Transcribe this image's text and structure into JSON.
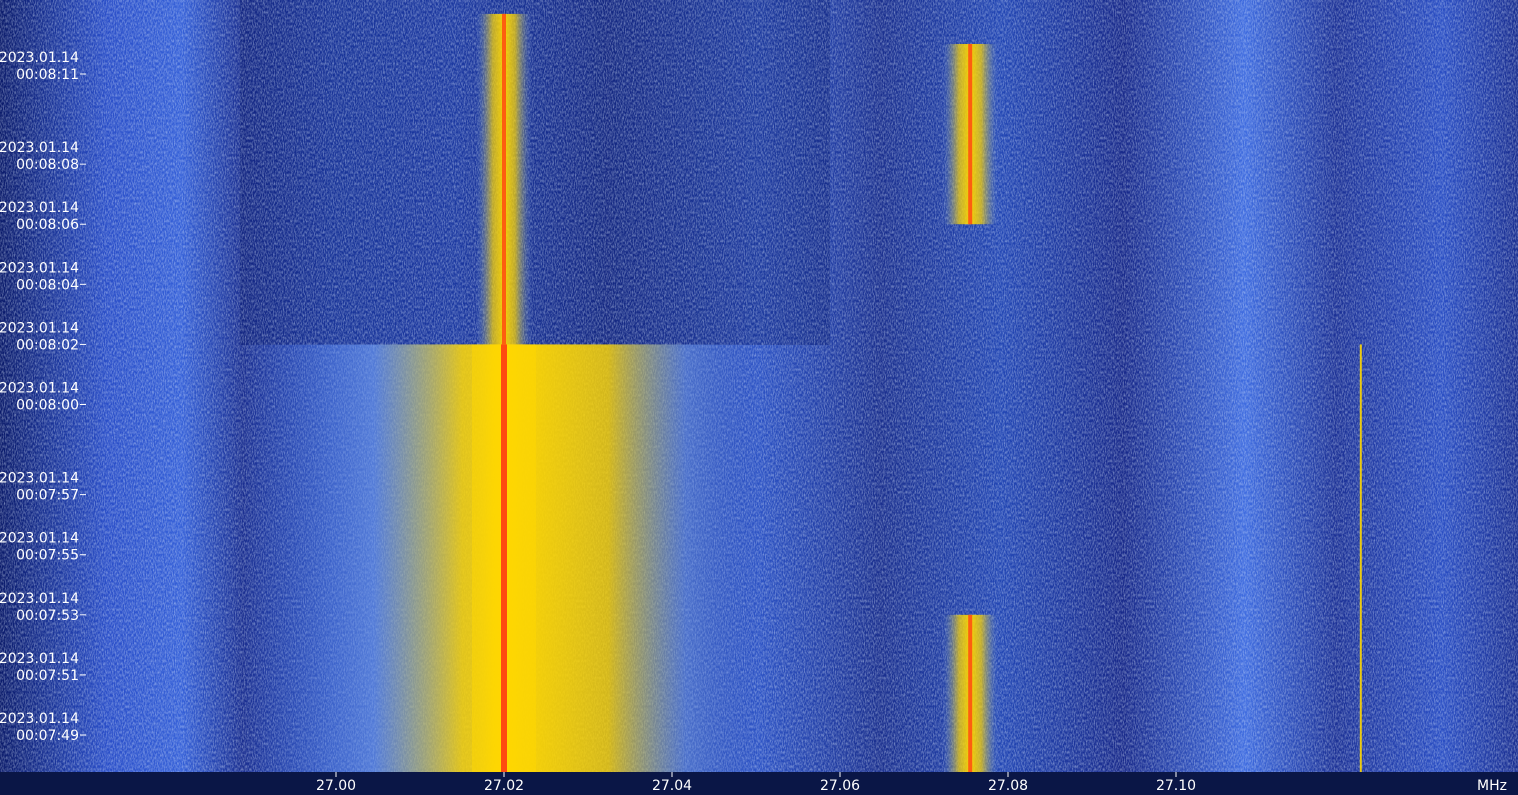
{
  "chart_data": {
    "type": "heatmap",
    "subtype": "waterfall-spectrogram",
    "x_unit_label": "MHz",
    "x_ticks": [
      "27.00",
      "27.02",
      "27.04",
      "27.06",
      "27.08",
      "27.10"
    ],
    "x_range": [
      26.97,
      27.14
    ],
    "y_ticks": [
      {
        "date": "2023.01.14",
        "time": "00:08:11"
      },
      {
        "date": "2023.01.14",
        "time": "00:08:08"
      },
      {
        "date": "2023.01.14",
        "time": "00:08:06"
      },
      {
        "date": "2023.01.14",
        "time": "00:08:04"
      },
      {
        "date": "2023.01.14",
        "time": "00:08:02"
      },
      {
        "date": "2023.01.14",
        "time": "00:08:00"
      },
      {
        "date": "2023.01.14",
        "time": "00:07:57"
      },
      {
        "date": "2023.01.14",
        "time": "00:07:55"
      },
      {
        "date": "2023.01.14",
        "time": "00:07:53"
      },
      {
        "date": "2023.01.14",
        "time": "00:07:51"
      },
      {
        "date": "2023.01.14",
        "time": "00:07:49"
      }
    ],
    "signals": [
      {
        "center_mhz": 27.02,
        "start": "00:07:47",
        "end": "00:08:13",
        "strength": "strong"
      },
      {
        "center_mhz": 27.02,
        "start": "00:07:47",
        "end": "00:08:02",
        "strength": "very strong",
        "bandwidth_mhz": 0.025
      },
      {
        "center_mhz": 27.0755,
        "start": "00:08:06",
        "end": "00:08:12",
        "strength": "strong"
      },
      {
        "center_mhz": 27.0755,
        "start": "00:07:47",
        "end": "00:07:53",
        "strength": "strong"
      },
      {
        "center_mhz": 27.122,
        "start": "00:07:47",
        "end": "00:08:02",
        "strength": "weak carrier"
      }
    ],
    "colors": {
      "low": "#0a1a6a",
      "mid": "#3f6ce0",
      "high": "#ffd700",
      "peak": "#ff4a10"
    },
    "grid": false
  }
}
